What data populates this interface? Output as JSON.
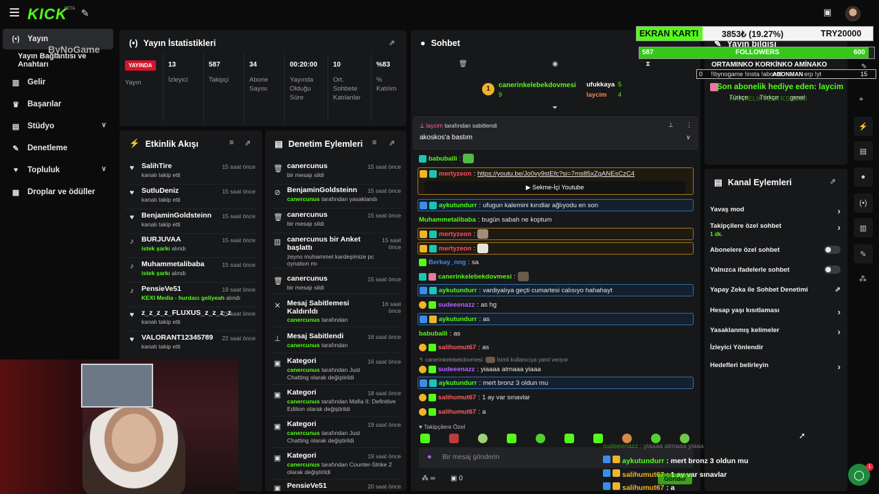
{
  "header": {
    "logo": "KICK",
    "beta": "BETA"
  },
  "sidebar": {
    "items": [
      {
        "label": "Yayın",
        "icon": "live-icon"
      },
      {
        "label": "Yayın Bağlantısı ve Anahtarı",
        "icon": ""
      },
      {
        "label": "Gelir",
        "icon": "revenue-icon"
      },
      {
        "label": "Başarılar",
        "icon": "trophy-icon"
      },
      {
        "label": "Stüdyo",
        "icon": "studio-icon"
      },
      {
        "label": "Denetleme",
        "icon": "wrench-icon"
      },
      {
        "label": "Topluluk",
        "icon": "community-icon"
      },
      {
        "label": "Droplar ve ödüller",
        "icon": "drops-icon"
      }
    ],
    "watermark": "ByNoGame"
  },
  "stats": {
    "title": "Yayın İstatistikleri",
    "live": "YAYINDA",
    "live_label": "Yayın",
    "items": [
      {
        "value": "13",
        "label": "İzleyici"
      },
      {
        "value": "587",
        "label": "Takipçi"
      },
      {
        "value": "34",
        "label": "Abone Sayısı"
      },
      {
        "value": "00:20:00",
        "label": "Yayında Olduğu Süre"
      },
      {
        "value": "10",
        "label": "Ort. Sohbete Katılanlar"
      },
      {
        "value": "%83",
        "label": "% Katılım"
      }
    ]
  },
  "activity": {
    "title": "Etkinlik Akışı",
    "items": [
      {
        "name": "SalihTire",
        "sub": "kanalı takip etti",
        "time": "15 saat önce"
      },
      {
        "name": "SutluDeniz",
        "sub": "kanalı takip etti",
        "time": "15 saat önce"
      },
      {
        "name": "BenjaminGoldsteinn",
        "sub": "kanalı takip etti",
        "time": "15 saat önce"
      },
      {
        "name": "BURJUVAA",
        "sub_green": "istek şarkı",
        "sub": "alındı",
        "time": "15 saat önce"
      },
      {
        "name": "Muhammetalibaba",
        "sub_green": "istek şarkı",
        "sub": "alındı",
        "time": "15 saat önce"
      },
      {
        "name": "PensieVe51",
        "sub_green": "KEXI Media - hurdacı geliyeah",
        "sub": "alındı",
        "time": "19 saat önce"
      },
      {
        "name": "z_z_z_z_FLUXUS_z_z_z_z",
        "sub": "kanalı takip etti",
        "time": "21 saat önce"
      },
      {
        "name": "VALORANT12345789",
        "sub": "kanalı takip etti",
        "time": "22 saat önce"
      }
    ]
  },
  "moderation": {
    "title": "Denetim Eylemleri",
    "items": [
      {
        "name": "canercunus",
        "sub": "bir mesajı sildi",
        "time": "15 saat önce"
      },
      {
        "name": "BenjaminGoldsteinn",
        "sub_green": "canercunus",
        "sub": "tarafından yasaklandı",
        "time": "15 saat önce"
      },
      {
        "name": "canercunus",
        "sub": "bir mesajı sildi",
        "time": "15 saat önce"
      },
      {
        "name": "canercunus bir Anket başlattı",
        "sub": "zeyno muhammet kardeşimize pc oynatsın mı",
        "time": "15 saat önce"
      },
      {
        "name": "canercunus",
        "sub": "bir mesajı sildi",
        "time": "15 saat önce"
      },
      {
        "name": "Mesaj Sabitlemesi Kaldırıldı",
        "sub_green": "canercunus",
        "sub": "tarafından",
        "time": "16 saat önce"
      },
      {
        "name": "Mesaj Sabitlendi",
        "sub_green": "canercunus",
        "sub": "tarafından",
        "time": "16 saat önce"
      },
      {
        "name": "Kategori",
        "sub_green": "canercunus",
        "sub": "tarafından Just Chatting olarak değiştirildi",
        "time": "16 saat önce"
      },
      {
        "name": "Kategori",
        "sub_green": "canercunus",
        "sub": "tarafından Mafia II: Definitive Edition olarak değiştirildi",
        "time": "18 saat önce"
      },
      {
        "name": "Kategori",
        "sub_green": "canercunus",
        "sub": "tarafından Just Chatting olarak değiştirildi",
        "time": "19 saat önce"
      },
      {
        "name": "Kategori",
        "sub_green": "canercunus",
        "sub": "tarafından Counter-Strike 2 olarak değiştirildi",
        "time": "19 saat önce"
      },
      {
        "name": "PensieVe51",
        "sub": "",
        "time": "20 saat önce"
      }
    ]
  },
  "chat": {
    "title": "Sohbet",
    "leaderboard": [
      {
        "name": "canerinkelebekdovmesi",
        "count": "9"
      },
      {
        "name": "ufukkaya",
        "count": "5"
      },
      {
        "name": "laycim",
        "count": "4"
      }
    ],
    "pinned_by": "laycim",
    "pinned_suffix": "tarafından sabitlendi",
    "pinned_text": "akoskos'a bastım",
    "messages": [
      {
        "user": "babuballi",
        "text": "",
        "color": "#53fc18"
      },
      {
        "user": "mertyzeon",
        "text": "https://youtu.be/Jo0vy9stEfc?si=7ms85xZgANEsCzC4",
        "color": "#ff4b6e"
      },
      {
        "user": "aykutundurr",
        "text": "ufugun kalemini kırıdlar ağlıyodu en son",
        "color": "#53fc18"
      },
      {
        "user": "Muhammetalibaba",
        "text": "bugün sabah ne koptum",
        "color": "#53fc18"
      },
      {
        "user": "mertyzeon",
        "text": "",
        "color": "#ff4b6e"
      },
      {
        "user": "mertyzeon",
        "text": "",
        "color": "#ff4b6e"
      },
      {
        "user": "Berkay_nng",
        "text": "sa",
        "color": "#3a8ee6"
      },
      {
        "user": "canerinkelebekdovmesi",
        "text": "",
        "color": "#53fc18"
      },
      {
        "user": "aykutundurr",
        "text": "vardiyalıya geçti cumartesi calısıyo hahahayt",
        "color": "#53fc18"
      },
      {
        "user": "sudeeenazz",
        "text": "as hg",
        "color": "#b266ff"
      },
      {
        "user": "aykutundurr",
        "text": "as",
        "color": "#53fc18"
      },
      {
        "user": "babuballi",
        "text": "as",
        "color": "#53fc18"
      },
      {
        "user": "salihumut67",
        "text": "as",
        "color": "#ff5c5c"
      },
      {
        "user": "sudeeenazz",
        "text": "yiaaaa atmaaa yiaaa",
        "color": "#b266ff"
      },
      {
        "user": "aykutundurr",
        "text": "mert bronz 3 oldun mu",
        "color": "#53fc18"
      },
      {
        "user": "salihumut67",
        "text": "1 ay var sınavlar",
        "color": "#ff5c5c"
      },
      {
        "user": "salihumut67",
        "text": "a",
        "color": "#ff5c5c"
      }
    ],
    "youtube_label": "Sekme-İçi Youtube",
    "reply_from": "canerinkelebekdovmesi:",
    "reply_text": "İsimli kullanıcıya yanıt veriyor",
    "followers_label": "Takipçilere Özel",
    "input_placeholder": "Bir mesaj gönderin",
    "points": "0",
    "send_label": "Gönder"
  },
  "overlay": {
    "card_label": "EKRAN KARTI",
    "card_value": "3853₺ (19.27%)",
    "card_goal": "TRY20000",
    "followers_current": "587",
    "followers_label": "FOLLOWERS",
    "followers_goal": "600",
    "followers_progress": 0.978,
    "ticker": "ORTAMINKO KORKİNKO AMİNAKO",
    "sub_left": "0",
    "sub_text": "!!bynogame !insta !abonel",
    "sub_right_label": "ABONMAN",
    "sub_right_value": "15",
    "sub_tail": "erp !yt",
    "gift": "Son abonelik hediye eden: laycim",
    "ghost": "HARTELİKTERTKS 2000",
    "tabs": [
      "Türkçe",
      "Türkçe",
      "genel"
    ],
    "chat_lines": [
      {
        "user": "sudeeenazz",
        "text": "yiaaaa atmaaa yiaaa"
      },
      {
        "user": "aykutundurr",
        "text": "mert bronz 3 oldun mu"
      },
      {
        "user": "salihumut67",
        "text": "1 ay var sınavlar"
      },
      {
        "user": "salihumut67",
        "text": "a"
      }
    ]
  },
  "stream_info": {
    "title": "Yayın bilgisi"
  },
  "channel_actions": {
    "title": "Kanal Eylemleri",
    "items": [
      {
        "label": "Yavaş mod",
        "control": "arrow"
      },
      {
        "label": "Takipçilere özel sohbet",
        "sub": "1 dk.",
        "control": "arrow"
      },
      {
        "label": "Abonelere özel sohbet",
        "control": "toggle"
      },
      {
        "label": "Yalnızca ifadelerle sohbet",
        "control": "toggle"
      },
      {
        "label": "Yapay Zeka ile Sohbet Denetimi",
        "control": "external"
      },
      {
        "label": "Hesap yaşı kısıtlaması",
        "control": "arrow"
      },
      {
        "label": "Yasaklanmış kelimeler",
        "control": "arrow"
      },
      {
        "label": "İzleyici Yönlendir",
        "control": "none"
      },
      {
        "label": "Hedefleri belirleyin",
        "control": "arrow"
      }
    ]
  },
  "notifications": {
    "count": "1"
  }
}
